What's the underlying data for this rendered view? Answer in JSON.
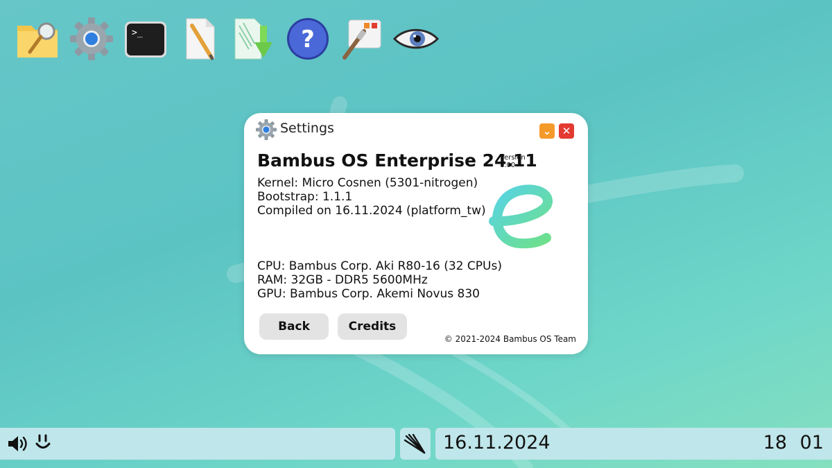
{
  "launcher": {
    "items": [
      {
        "name": "file-search-icon"
      },
      {
        "name": "settings-gear-icon"
      },
      {
        "name": "terminal-icon"
      },
      {
        "name": "text-editor-icon"
      },
      {
        "name": "install-download-icon"
      },
      {
        "name": "help-question-icon"
      },
      {
        "name": "appearance-brush-icon"
      },
      {
        "name": "eye-viewer-icon"
      }
    ]
  },
  "window": {
    "title": "Settings",
    "minimize_label": "⌄",
    "close_label": "✕",
    "product_name": "Bambus OS Enterprise 24.11",
    "version_label": "Version",
    "version_number": "1.00",
    "kernel": "Kernel: Micro Cosnen (5301-nitrogen)",
    "bootstrap": "Bootstrap: 1.1.1",
    "compiled": "Compiled on 16.11.2024 (platform_tw)",
    "cpu": "CPU: Bambus Corp. Aki R80-16 (32 CPUs)",
    "ram": "RAM: 32GB - DDR5 5600MHz",
    "gpu": "GPU: Bambus Corp. Akemi Novus 830",
    "back_label": "Back",
    "credits_label": "Credits",
    "copyright": "© 2021-2024 Bambus OS Team"
  },
  "taskbar": {
    "date": "16.11.2024",
    "time": "18 01"
  },
  "colors": {
    "minimize": "#f49a2a",
    "close": "#e33a31",
    "taskbar": "#bfe6ea"
  }
}
